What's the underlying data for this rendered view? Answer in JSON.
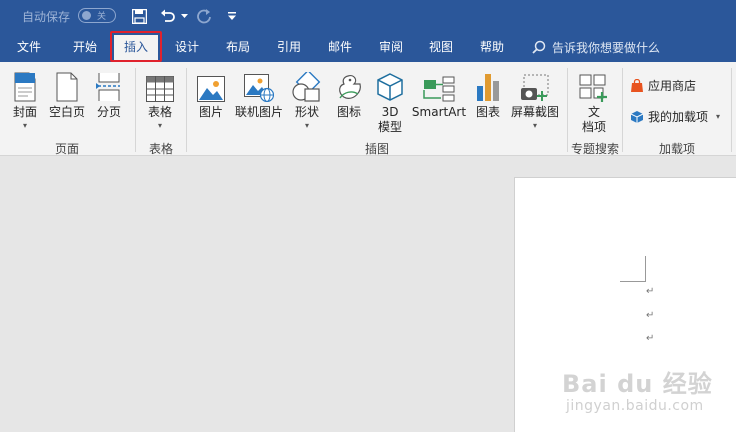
{
  "quick_access": {
    "autosave_label": "自动保存",
    "autosave_state": "关"
  },
  "tabs": [
    {
      "label": "文件"
    },
    {
      "label": "开始"
    },
    {
      "label": "插入"
    },
    {
      "label": "设计"
    },
    {
      "label": "布局"
    },
    {
      "label": "引用"
    },
    {
      "label": "邮件"
    },
    {
      "label": "审阅"
    },
    {
      "label": "视图"
    },
    {
      "label": "帮助"
    }
  ],
  "search": {
    "placeholder": "告诉我你想要做什么"
  },
  "ribbon": {
    "pages_group": {
      "label": "页面",
      "buttons": [
        "封面",
        "空白页",
        "分页"
      ]
    },
    "table_group": {
      "label": "表格",
      "button": "表格"
    },
    "illustrations_group": {
      "label": "插图",
      "buttons": [
        "图片",
        "联机图片",
        "形状",
        "图标",
        "3D",
        "模型",
        "SmartArt",
        "图表",
        "屏幕截图"
      ]
    },
    "topic_group": {
      "label": "专题搜索",
      "button_line1": "文",
      "button_line2": "档项"
    },
    "addins_group": {
      "label": "加载项",
      "store": "应用商店",
      "my_addins": "我的加载项"
    }
  },
  "document": {
    "paragraph_mark": "↵"
  },
  "watermark": {
    "main": "Bai du 经验",
    "sub": "jingyan.baidu.com"
  },
  "colors": {
    "titlebar": "#2b579a",
    "ribbon": "#f3f3f3",
    "highlight": "#e0222d",
    "accent": "#2b579a"
  }
}
